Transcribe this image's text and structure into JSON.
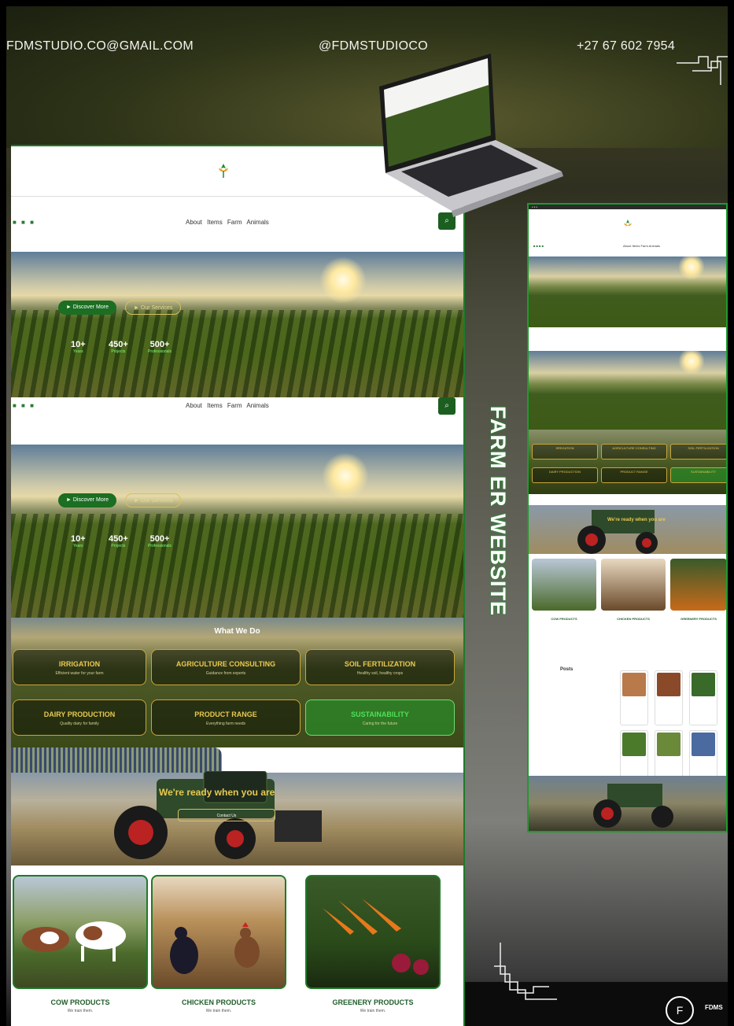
{
  "header": {
    "email": "FDMSTUDIO.CO@GMAIL.COM",
    "handle": "@FDMSTUDIOCO",
    "phone": "+27 67 602 7954"
  },
  "side_title": "FARM ER WEBSITE",
  "nav": {
    "links": "About Items Farm Animals"
  },
  "hero": {
    "discover_label": "► Discover More",
    "services_label": "► Our Services",
    "stats": [
      {
        "value": "10+",
        "label": "Years"
      },
      {
        "value": "450+",
        "label": "Projects"
      },
      {
        "value": "500+",
        "label": "Professionals"
      }
    ]
  },
  "services": {
    "title": "What We Do",
    "cards": [
      {
        "title": "IRRIGATION",
        "sub": "Efficient water for your farm"
      },
      {
        "title": "AGRICULTURE CONSULTING",
        "sub": "Guidance from experts"
      },
      {
        "title": "SOIL FERTILIZATION",
        "sub": "Healthy soil, healthy crops"
      },
      {
        "title": "DAIRY PRODUCTION",
        "sub": "Quality dairy for family"
      },
      {
        "title": "PRODUCT RANGE",
        "sub": "Everything farm needs"
      },
      {
        "title": "SUSTAINABILITY",
        "sub": "Caring for the future"
      }
    ]
  },
  "cta": {
    "headline": "We're ready when you are",
    "button": "Contact Us"
  },
  "products": [
    {
      "title": "COW PRODUCTS",
      "sub": "We train them."
    },
    {
      "title": "CHICKEN PRODUCTS",
      "sub": "We train them."
    },
    {
      "title": "GREENERY PRODUCTS",
      "sub": "We train them."
    }
  ],
  "preview": {
    "posts_title": "Posts",
    "cta_headline": "We're ready when you are",
    "products": [
      "COW PRODUCTS",
      "CHICKEN PRODUCTS",
      "GREENERY PRODUCTS"
    ],
    "services": [
      "IRRIGATION",
      "AGRICULTURE CONSULTING",
      "SOIL FERTILIZATION",
      "DAIRY PRODUCTION",
      "PRODUCT RANGE",
      "SUSTAINABILITY"
    ]
  },
  "brand": {
    "badge": "F",
    "name": "FDMS",
    "accent": "#1f9a2e",
    "gold": "#e9c950"
  }
}
